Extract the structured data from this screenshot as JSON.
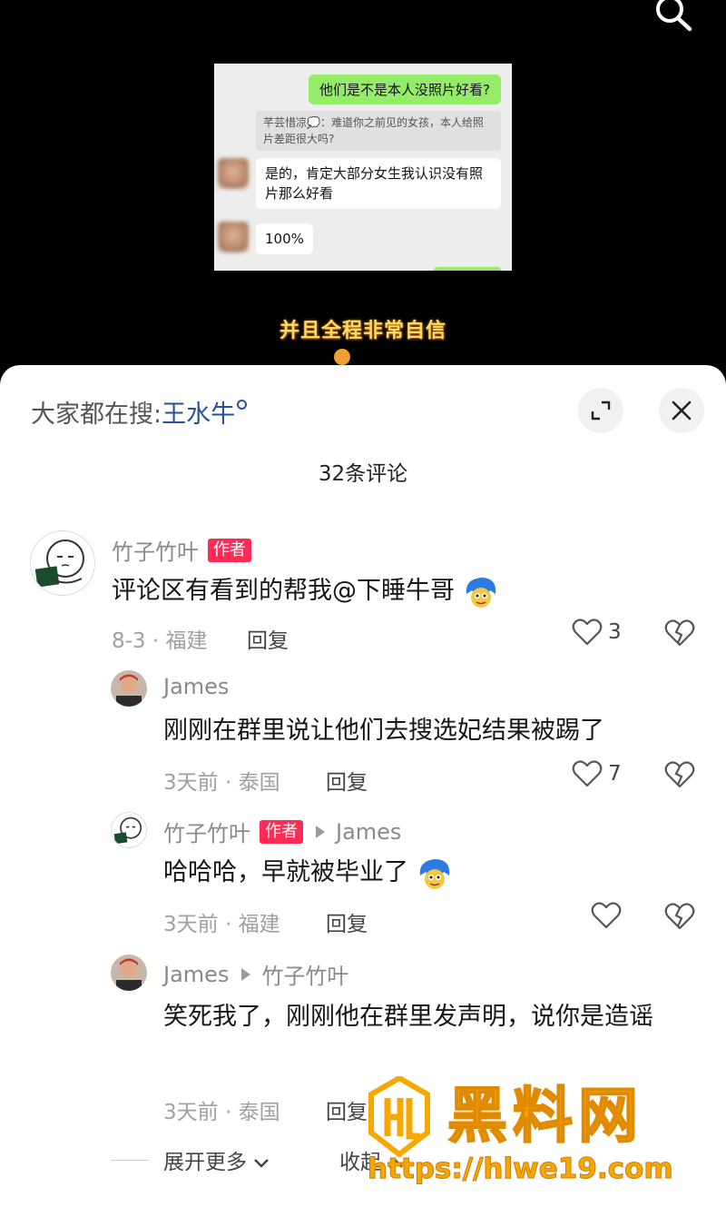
{
  "video": {
    "chat": {
      "outgoing": "他们是不是本人没照片好看?",
      "quote": "芊芸惜凉💭：难道你之前见的女孩，本人给照片差距很大吗?",
      "reply1": "是的，肯定大部分女生我认识没有照片那么好看",
      "reply2": "100%"
    },
    "caption": "并且全程非常自信"
  },
  "sheet": {
    "hot_search_prefix": "大家都在搜:",
    "hot_search_term": "王水牛",
    "comment_count": "32条评论",
    "author_tag": "作者",
    "reply_label": "回复",
    "comments": [
      {
        "author": "竹子竹叶",
        "text": "评论区有看到的帮我@下睡牛哥",
        "meta": "8-3 · 福建",
        "likes": "3"
      },
      {
        "author": "James",
        "text": "刚刚在群里说让他们去搜选妃结果被踢了",
        "meta": "3天前 · 泰国",
        "likes": "7"
      },
      {
        "author": "竹子竹叶",
        "reply_to": "James",
        "text": "哈哈哈，早就被毕业了",
        "meta": "3天前 · 福建",
        "likes": ""
      },
      {
        "author": "James",
        "reply_to": "竹子竹叶",
        "text": "笑死我了，刚刚他在群里发声明，说你是造谣",
        "meta": "3天前 · 泰国",
        "likes": ""
      }
    ],
    "expand_more": "展开更多",
    "collapse": "收起"
  },
  "watermark": {
    "title": "黑料网",
    "url": "https://hlwe19.com"
  },
  "colors": {
    "author_tag": "#fe2c55",
    "hot_search_term": "#26529b",
    "wechat_green": "#95ec69",
    "watermark": "#f7a800"
  },
  "icons": [
    "search-icon",
    "expand-icon",
    "close-icon",
    "heart-icon",
    "broken-heart-icon",
    "chevron-down-icon",
    "chevron-up-icon"
  ]
}
